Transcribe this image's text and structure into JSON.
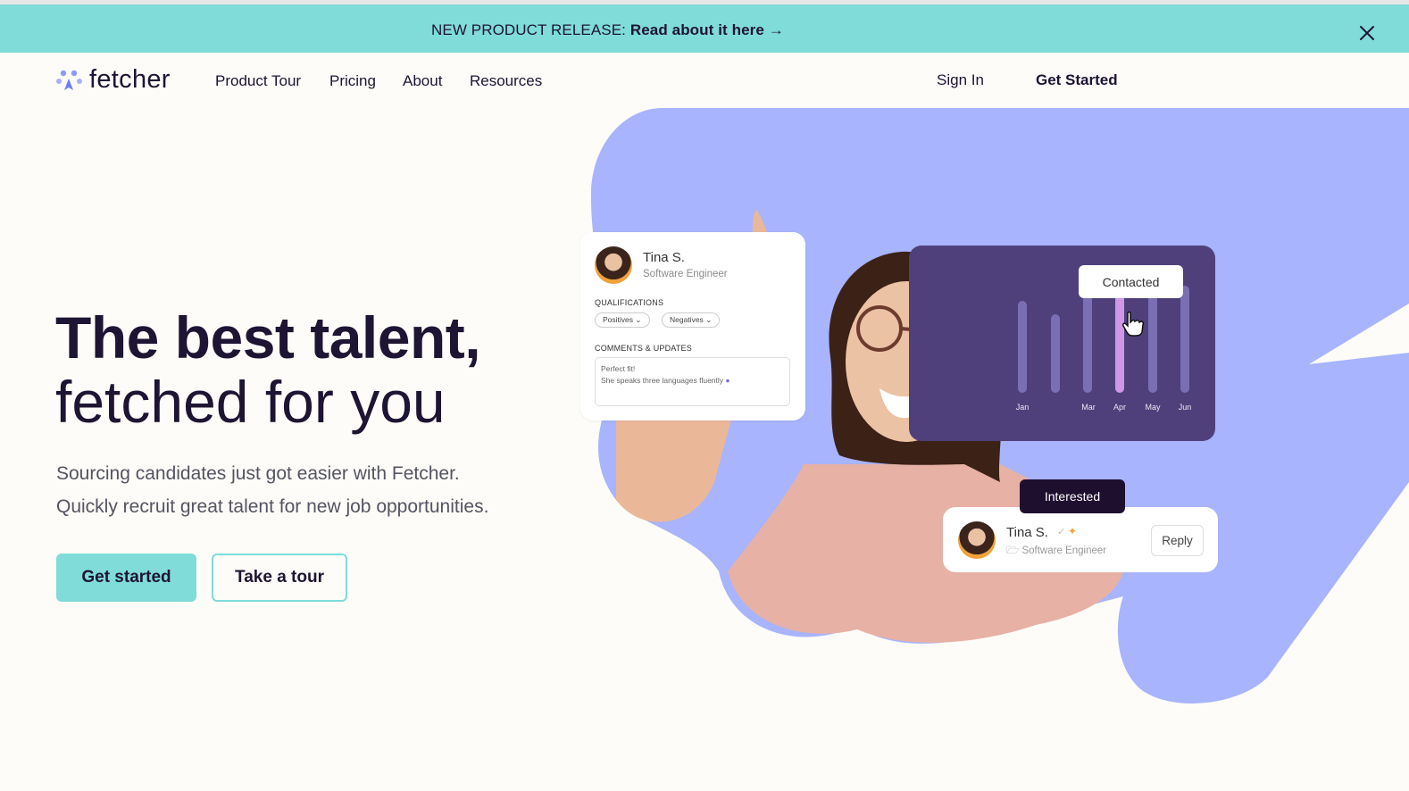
{
  "banner": {
    "prefix": "NEW PRODUCT RELEASE:",
    "link_label": "Read about it here →",
    "close_icon": "close-icon"
  },
  "nav": {
    "logo_text": "fetcher",
    "links": [
      "Product Tour",
      "Pricing",
      "About",
      "Resources"
    ],
    "sign_in": "Sign In",
    "get_started": "Get Started"
  },
  "hero": {
    "title_line1": "The best talent,",
    "title_line2": "fetched for you",
    "subtitle_line1": "Sourcing candidates just got easier with Fetcher.",
    "subtitle_line2": "Quickly recruit great talent for new job opportunities.",
    "primary_cta": "Get started",
    "secondary_cta": "Take a tour"
  },
  "profile_card": {
    "name": "Tina S.",
    "role": "Software Engineer",
    "qualifications_label": "QUALIFICATIONS",
    "positives": "Positives",
    "negatives": "Negatives",
    "comments_label": "COMMENTS & UPDATES",
    "comment_line1": "Perfect fit!",
    "comment_line2": "She speaks three languages fluently"
  },
  "chart_card": {
    "tooltip": "Contacted",
    "months": [
      "Jan",
      "",
      "Mar",
      "Apr",
      "May",
      "Jun"
    ],
    "highlight_month": "Apr"
  },
  "reply_card": {
    "badge": "Interested",
    "name": "Tina S.",
    "role": "Software Engineer",
    "reply_label": "Reply"
  },
  "colors": {
    "accent_teal": "#7fdcd8",
    "blob_periwinkle": "#a8b4fd",
    "chart_panel": "#4f407c",
    "dark_text": "#1e1433",
    "highlight_bar": "#cf97e6"
  }
}
